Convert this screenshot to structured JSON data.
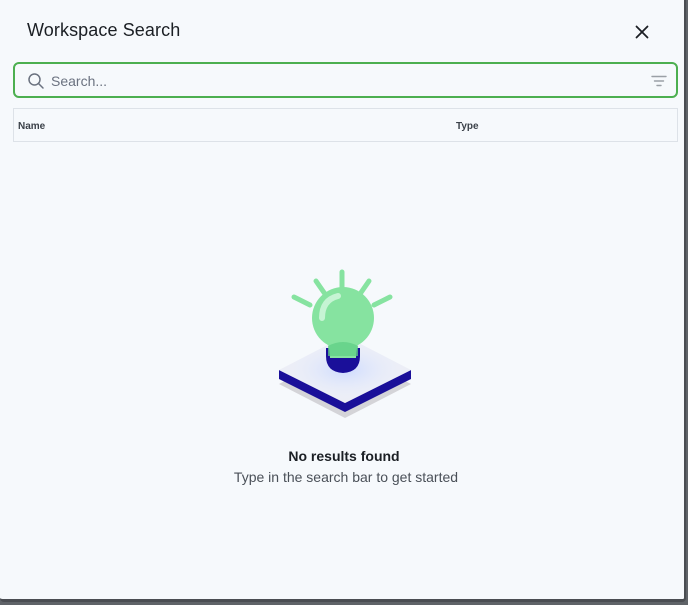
{
  "dialog": {
    "title": "Workspace Search",
    "close_icon": "close-icon"
  },
  "search": {
    "placeholder": "Search...",
    "value": "",
    "search_icon": "search-icon",
    "filter_icon": "filter-icon",
    "border_color": "#4caf50"
  },
  "table": {
    "columns": [
      "Name",
      "Type"
    ]
  },
  "empty_state": {
    "illustration": "lightbulb-illustration",
    "title": "No results found",
    "subtitle": "Type in the search bar to get started",
    "bulb_color": "#86e3a0",
    "base_color": "#1a0f99"
  }
}
